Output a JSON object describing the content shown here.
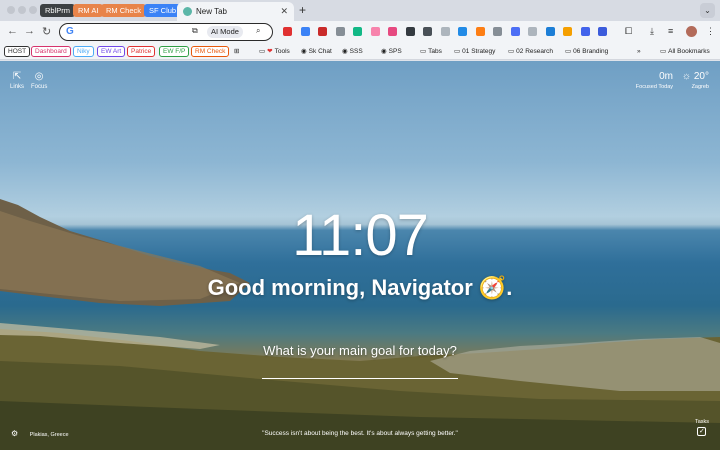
{
  "tab_groups": [
    {
      "label": "RblPrm",
      "color": "#3c4043"
    },
    {
      "label": "RM AI",
      "color": "#e8844a"
    },
    {
      "label": "RM Check",
      "color": "#e8844a"
    },
    {
      "label": "SF Club",
      "color": "#3b82f6"
    }
  ],
  "active_tab": {
    "title": "New Tab",
    "close": "✕"
  },
  "new_tab_symbol": "+",
  "tab_dropdown_symbol": "⌄",
  "omnibox": {
    "placeholder": "",
    "ai_mode_label": "AI Mode"
  },
  "bookmark_chips": [
    {
      "label": "HOST",
      "color": "#333333"
    },
    {
      "label": "Dashboard",
      "color": "#d6336c"
    },
    {
      "label": "Niky",
      "color": "#4dabf7"
    },
    {
      "label": "EW Art",
      "color": "#7048e8"
    },
    {
      "label": "Patrice",
      "color": "#e03131"
    },
    {
      "label": "EW F/P",
      "color": "#2f9e44"
    },
    {
      "label": "RM Check",
      "color": "#e8590c"
    }
  ],
  "bookmark_links": [
    {
      "label": "Tools",
      "icon": "❤"
    },
    {
      "label": "Sk Chat",
      "icon": "◉"
    },
    {
      "label": "SSS",
      "icon": "◉"
    },
    {
      "label": "SPS",
      "icon": "◉"
    },
    {
      "label": "Tabs",
      "icon": "▭"
    },
    {
      "label": "01 Strategy",
      "icon": "▭"
    },
    {
      "label": "02 Research",
      "icon": "▭"
    },
    {
      "label": "06 Branding",
      "icon": "▭"
    }
  ],
  "bookmarks_overflow": "»",
  "all_bookmarks": "All Bookmarks",
  "ntp": {
    "links_label": "Links",
    "focus_label": "Focus",
    "focused_value": "0m",
    "focused_label": "Focused Today",
    "temperature": "20°",
    "city": "Zagreb",
    "clock": "11:07",
    "greeting": "Good morning, Navigator 🧭.",
    "question": "What is your main goal for today?",
    "location": "Plakias, Greece",
    "quote": "\"Success isn't about being the best. It's about always getting better.\"",
    "tasks_label": "Tasks"
  },
  "extension_colors": [
    "#e03131",
    "#3b82f6",
    "#c92a2a",
    "#868e96",
    "#12b886",
    "#f783ac",
    "#e64980",
    "#343a40",
    "#495057",
    "#adb5bd",
    "#228be6",
    "#fd7e14",
    "#868e96",
    "#4c6ef5",
    "#adb5bd",
    "#1c7ed6",
    "#f59f00",
    "#4263eb",
    "#3b5bdb"
  ]
}
